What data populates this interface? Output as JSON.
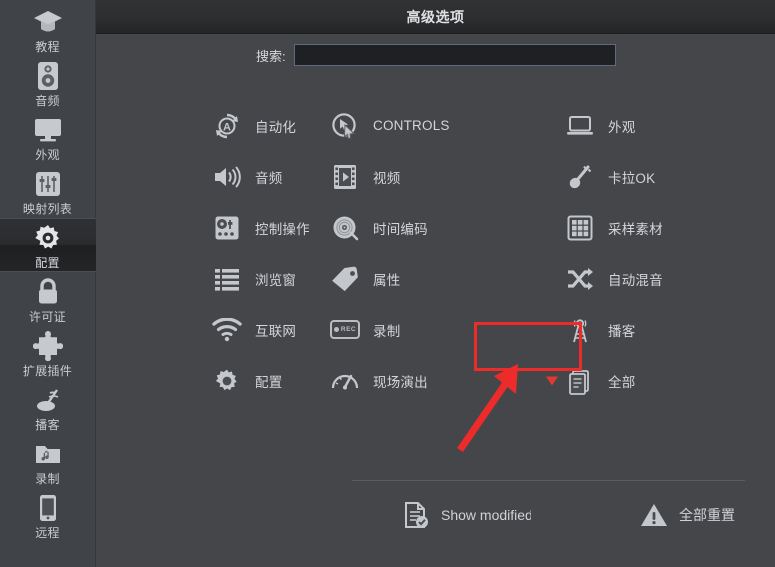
{
  "window": {
    "title": "高级选项"
  },
  "search": {
    "label": "搜索:",
    "value": "",
    "placeholder": ""
  },
  "sidebar": {
    "items": [
      {
        "label": "教程",
        "icon": "graduation-cap-icon",
        "active": false
      },
      {
        "label": "音频",
        "icon": "speaker-icon",
        "active": false
      },
      {
        "label": "外观",
        "icon": "monitor-icon",
        "active": false
      },
      {
        "label": "映射列表",
        "icon": "sliders-icon",
        "active": false
      },
      {
        "label": "配置",
        "icon": "gear-icon",
        "active": true
      },
      {
        "label": "许可证",
        "icon": "lock-icon",
        "active": false
      },
      {
        "label": "扩展插件",
        "icon": "puzzle-icon",
        "active": false
      },
      {
        "label": "播客",
        "icon": "broadcast-icon",
        "active": false
      },
      {
        "label": "录制",
        "icon": "music-folder-icon",
        "active": false
      },
      {
        "label": "远程",
        "icon": "phone-icon",
        "active": false
      }
    ]
  },
  "options": {
    "column1": [
      {
        "label": "自动化",
        "icon": "automation-icon"
      },
      {
        "label": "音频",
        "icon": "volume-icon"
      },
      {
        "label": "控制操作",
        "icon": "mixer-icon"
      },
      {
        "label": "浏览窗",
        "icon": "list-icon"
      },
      {
        "label": "互联网",
        "icon": "wifi-icon"
      },
      {
        "label": "配置",
        "icon": "gear-icon"
      }
    ],
    "column2": [
      {
        "label": "CONTROLS",
        "icon": "cursor-circle-icon"
      },
      {
        "label": "视频",
        "icon": "film-icon"
      },
      {
        "label": "时间编码",
        "icon": "vinyl-icon"
      },
      {
        "label": "属性",
        "icon": "tag-icon"
      },
      {
        "label": "录制",
        "icon": "rec-icon",
        "highlighted": true
      },
      {
        "label": "现场演出",
        "icon": "gauge-icon"
      }
    ],
    "column3": [
      {
        "label": "外观",
        "icon": "laptop-icon"
      },
      {
        "label": "卡拉OK",
        "icon": "microphone-icon"
      },
      {
        "label": "采样素材",
        "icon": "grid-icon"
      },
      {
        "label": "自动混音",
        "icon": "shuffle-icon"
      },
      {
        "label": "播客",
        "icon": "antenna-icon"
      },
      {
        "label": "全部",
        "icon": "documents-icon",
        "marker": true
      }
    ]
  },
  "footer": {
    "show_modified_label": "Show modified",
    "show_modified_icon": "document-check-icon",
    "reset_all_label": "全部重置",
    "reset_all_icon": "warning-triangle-icon"
  },
  "annotation": {
    "highlight_color": "#ee2b2b",
    "arrow_color": "#ee2b2b",
    "marker_color": "#e03a2f",
    "target": "录制"
  },
  "colors": {
    "sidebar_bg": "#404347",
    "main_bg": "#444649",
    "titlebar_bg": "#2c2e30",
    "text": "#d2d5da",
    "input_border": "#5d6b7c"
  }
}
